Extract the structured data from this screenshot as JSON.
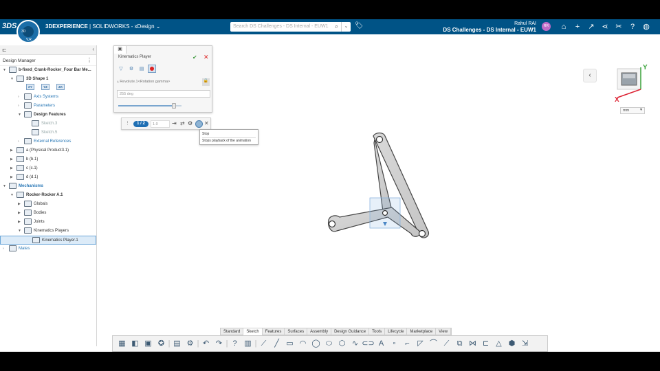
{
  "topbar": {
    "logo": "3DS",
    "brand_bold": "3DEXPERIENCE",
    "brand_rest": " | SOLIDWORKS - xDesign",
    "brand_chevron": "⌄",
    "search_placeholder": "Search DS Challenges - DS Internal - EUW1",
    "user_name": "Rahul RAI",
    "context": "DS Challenges - DS Internal - EUW1",
    "avatar_initials": "RR",
    "compass_label": "V,R"
  },
  "left_panel": {
    "title": "Design Manager",
    "tree": [
      {
        "label": "b-fixed_Crank-Rocker_Four Bar Me...",
        "indent": 0,
        "arrow": "▼",
        "style": "bold"
      },
      {
        "label": "3D Shape 1",
        "indent": 1,
        "arrow": "▼",
        "style": "bold"
      },
      {
        "label": "Axis Systems",
        "indent": 2,
        "arrow": "›",
        "style": "blue"
      },
      {
        "label": "Parameters",
        "indent": 2,
        "arrow": "›",
        "style": "blue"
      },
      {
        "label": "Design Features",
        "indent": 2,
        "arrow": "▼",
        "style": "bold"
      },
      {
        "label": "Sketch.3",
        "indent": 3,
        "arrow": "",
        "style": "grey"
      },
      {
        "label": "Sketch.5",
        "indent": 3,
        "arrow": "",
        "style": "grey"
      },
      {
        "label": "External References",
        "indent": 2,
        "arrow": "›",
        "style": "blue"
      },
      {
        "label": "a (Physical Product3.1)",
        "indent": 1,
        "arrow": "▶",
        "style": ""
      },
      {
        "label": "b (b.1)",
        "indent": 1,
        "arrow": "▶",
        "style": ""
      },
      {
        "label": "c (c.1)",
        "indent": 1,
        "arrow": "▶",
        "style": ""
      },
      {
        "label": "d (d.1)",
        "indent": 1,
        "arrow": "▶",
        "style": ""
      },
      {
        "label": "Mechanisms",
        "indent": 0,
        "arrow": "▼",
        "style": "blue bold"
      },
      {
        "label": "Rocker-Rocker A.1",
        "indent": 1,
        "arrow": "▼",
        "style": "bold"
      },
      {
        "label": "Globals",
        "indent": 2,
        "arrow": "▶",
        "style": ""
      },
      {
        "label": "Bodies",
        "indent": 2,
        "arrow": "▶",
        "style": ""
      },
      {
        "label": "Joints",
        "indent": 2,
        "arrow": "▶",
        "style": ""
      },
      {
        "label": "Kinematics Players",
        "indent": 2,
        "arrow": "▼",
        "style": ""
      },
      {
        "label": "Kinematics Player.1",
        "indent": 3,
        "arrow": "",
        "style": "sel"
      },
      {
        "label": "Mates",
        "indent": 0,
        "arrow": "›",
        "style": "blue"
      }
    ],
    "axis_badges": [
      "XY",
      "YZ",
      "ZX"
    ]
  },
  "kinematics_panel": {
    "title": "Kinematics Player",
    "joint": "Revolute.1<Rotation gamma>",
    "value": "255 deg",
    "slider_fraction": 0.88
  },
  "playback": {
    "frame": "1 / 2",
    "speed": "1.0",
    "tooltip_title": "Stop",
    "tooltip_desc": "Stops playback of the animation"
  },
  "viewcube": {
    "axis_y": "Y",
    "axis_x": "X"
  },
  "units": "mm",
  "bottom_tabs": [
    "Standard",
    "Sketch",
    "Features",
    "Surfaces",
    "Assembly",
    "Design Guidance",
    "Tools",
    "Lifecycle",
    "Marketplace",
    "View"
  ],
  "active_tab": "Sketch",
  "colors": {
    "topbar": "#005386",
    "accent": "#1f6fb3",
    "link": "#2a78b6",
    "stop_red": "#dd2222"
  }
}
